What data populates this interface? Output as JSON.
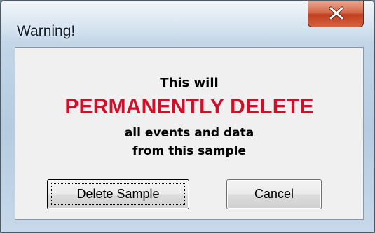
{
  "window": {
    "title": "Warning!"
  },
  "message": {
    "line1": "This will",
    "line2": "PERMANENTLY DELETE",
    "line3": "all events and data",
    "line4": "from this sample"
  },
  "buttons": {
    "delete_label": "Delete Sample",
    "cancel_label": "Cancel"
  },
  "icons": {
    "close": "close-icon"
  },
  "colors": {
    "warning_text": "#d0102a",
    "close_button": "#c0401f"
  }
}
